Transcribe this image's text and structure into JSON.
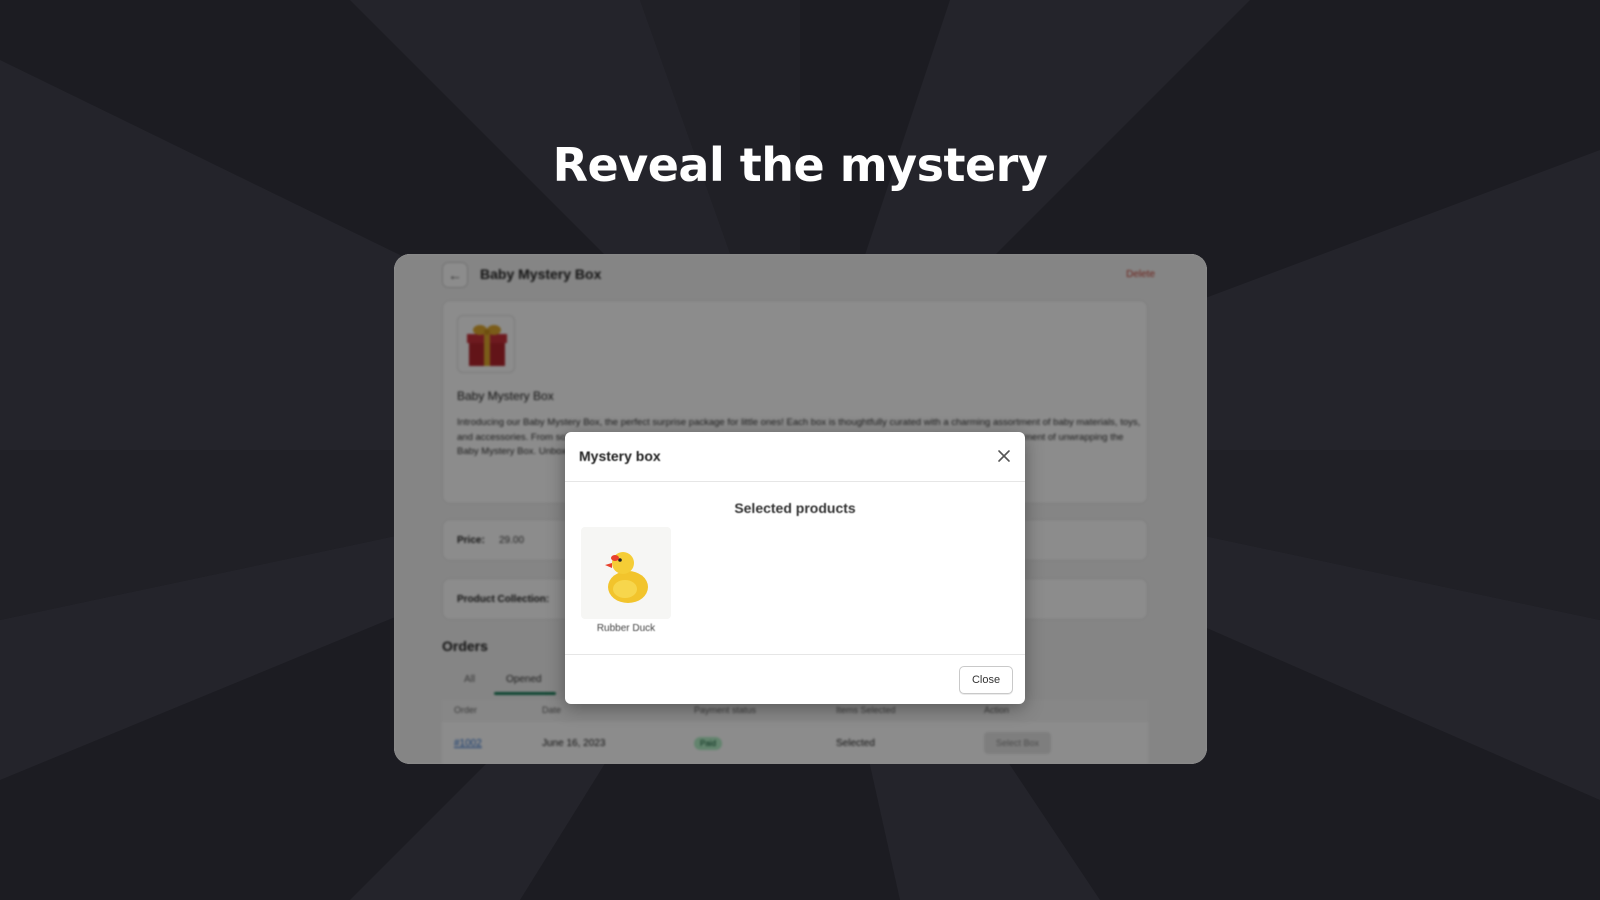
{
  "headline": "Reveal the mystery",
  "colors": {
    "background": "#1c1c22",
    "accent_green": "#1b7f5a",
    "delete_red": "#c0392b"
  },
  "app": {
    "title": "Baby Mystery Box",
    "delete_label": "Delete",
    "back_icon": "arrow-left-icon",
    "product": {
      "name": "Baby Mystery Box",
      "image_icon": "gift-box-icon",
      "description": "Introducing our Baby Mystery Box, the perfect surprise package for little ones! Each box is thoughtfully curated with a charming assortment of baby materials, toys, and accessories. From soft blankets and cute onesies to playful toys, each item brings joy to babies and parents. Experience the excitement of unwrapping the Baby Mystery Box. Unbox happiness today!"
    },
    "price_label": "Price:",
    "price_value": "29.00",
    "collection_label": "Product Collection:",
    "orders": {
      "title": "Orders",
      "tabs": [
        "All",
        "Opened"
      ],
      "columns": [
        "Order",
        "Date",
        "Payment status",
        "Items Selected",
        "Action"
      ],
      "rows": [
        {
          "order": "#1002",
          "date": "June 16, 2023",
          "payment_status": "Paid",
          "items_selected": "Selected",
          "action": "Select Box"
        }
      ]
    }
  },
  "modal": {
    "title": "Mystery box",
    "subtitle": "Selected products",
    "products": [
      {
        "name": "Rubber Duck",
        "icon": "rubber-duck-icon"
      }
    ],
    "close_button": "Close",
    "close_icon": "close-icon"
  }
}
